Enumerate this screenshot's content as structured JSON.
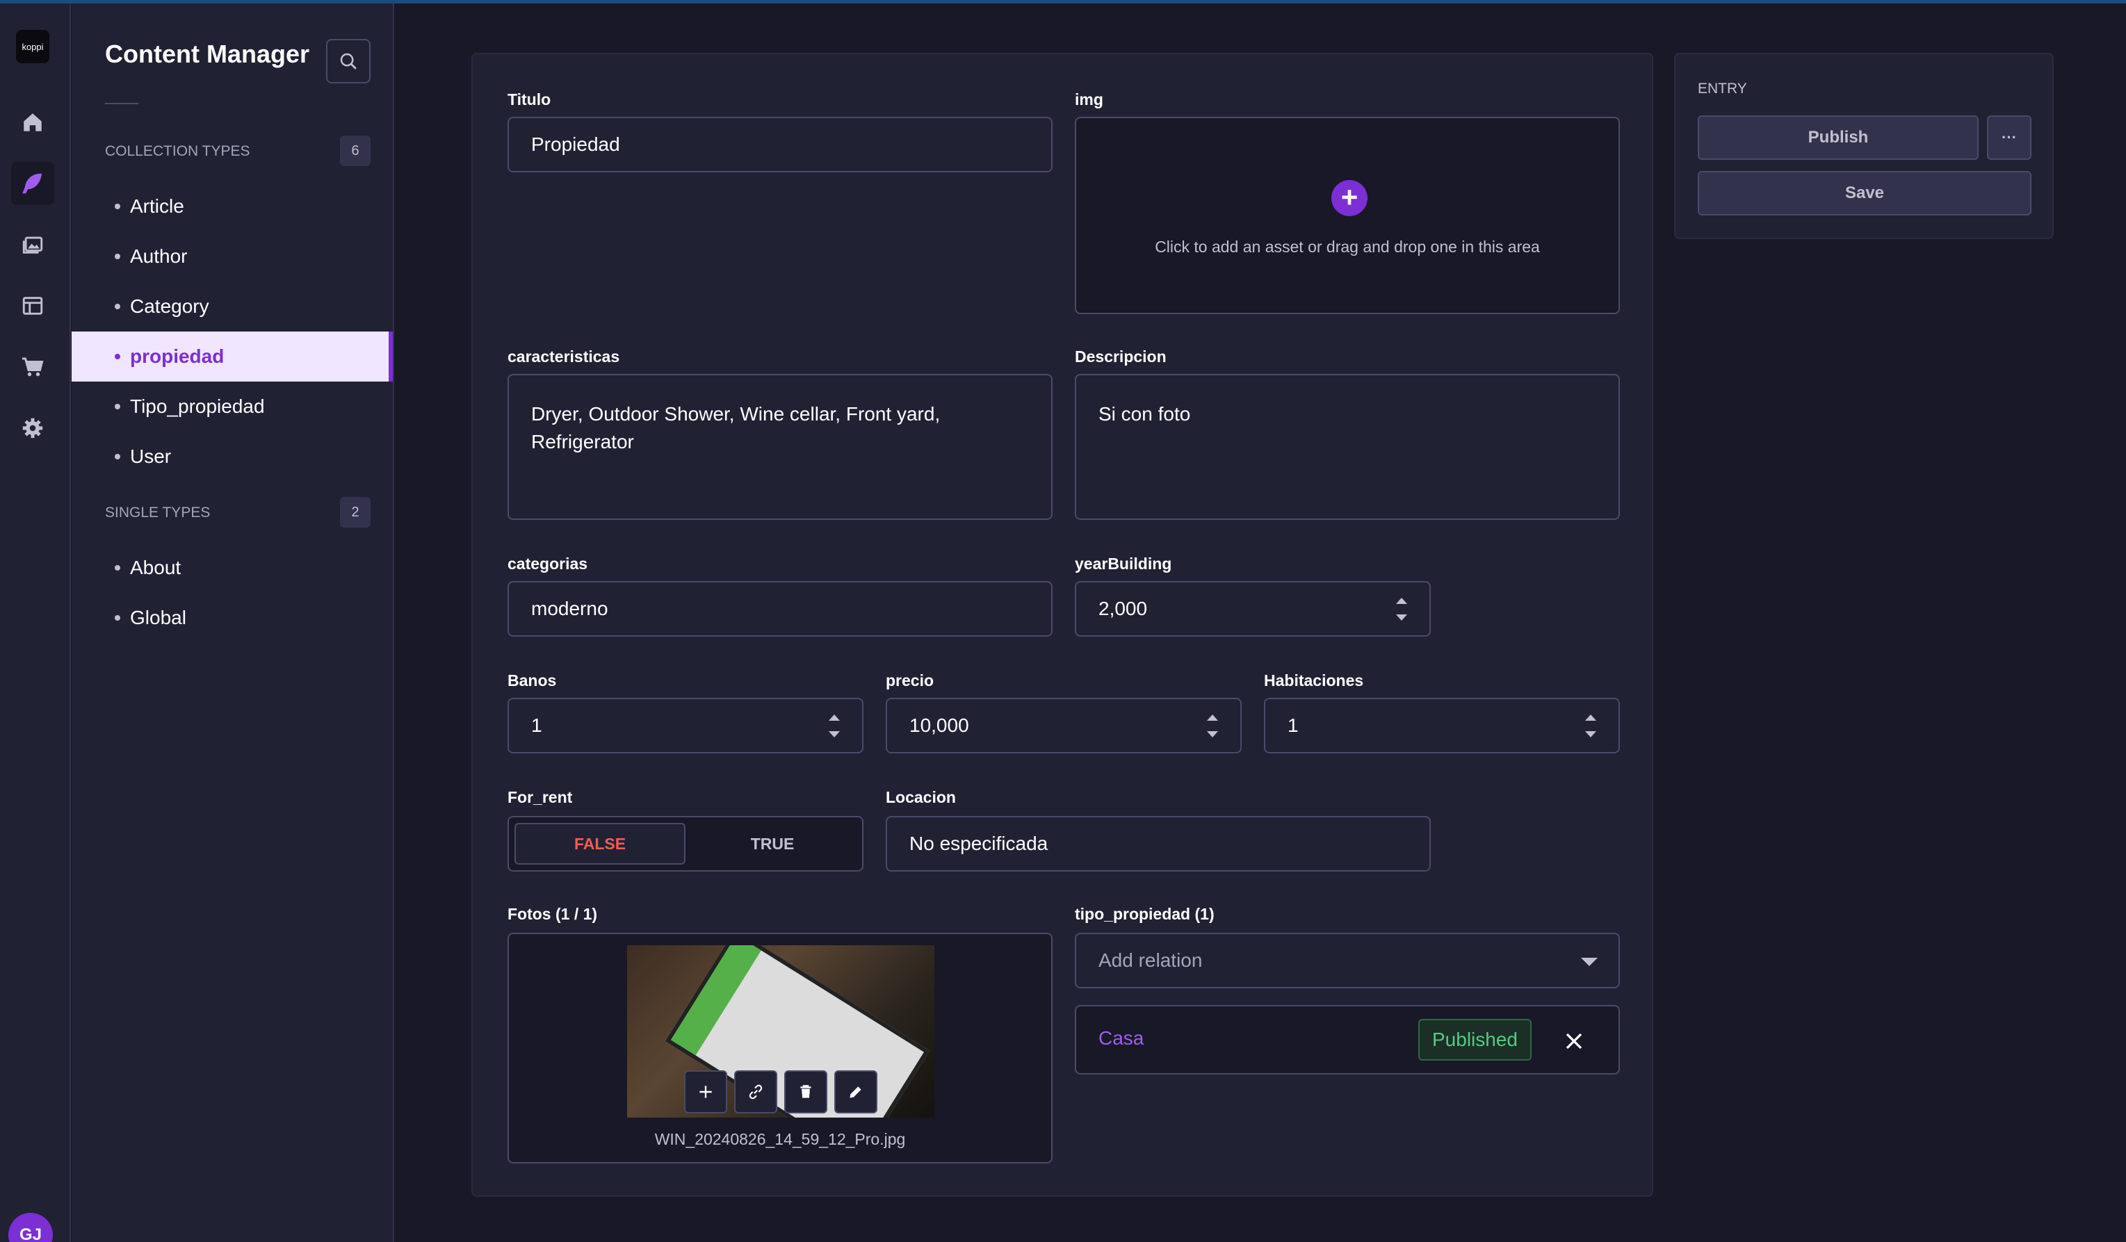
{
  "app": {
    "logo_text": "koppi",
    "avatar_initials": "GJ"
  },
  "subnav": {
    "title": "Content Manager",
    "collection_types": {
      "label": "COLLECTION TYPES",
      "count": "6",
      "items": [
        {
          "label": "Article"
        },
        {
          "label": "Author"
        },
        {
          "label": "Category"
        },
        {
          "label": "propiedad"
        },
        {
          "label": "Tipo_propiedad"
        },
        {
          "label": "User"
        }
      ]
    },
    "single_types": {
      "label": "SINGLE TYPES",
      "count": "2",
      "items": [
        {
          "label": "About"
        },
        {
          "label": "Global"
        }
      ]
    }
  },
  "form": {
    "titulo": {
      "label": "Titulo",
      "value": "Propiedad"
    },
    "img": {
      "label": "img",
      "hint": "Click to add an asset or drag and drop one in this area"
    },
    "caracteristicas": {
      "label": "caracteristicas",
      "value": "Dryer, Outdoor Shower, Wine cellar, Front yard, Refrigerator"
    },
    "descripcion": {
      "label": "Descripcion",
      "value": "Si con foto"
    },
    "categorias": {
      "label": "categorias",
      "value": "moderno"
    },
    "yearBuilding": {
      "label": "yearBuilding",
      "value": "2,000"
    },
    "banos": {
      "label": "Banos",
      "value": "1"
    },
    "precio": {
      "label": "precio",
      "value": "10,000"
    },
    "habitaciones": {
      "label": "Habitaciones",
      "value": "1"
    },
    "for_rent": {
      "label": "For_rent",
      "false_label": "FALSE",
      "true_label": "TRUE",
      "selected": "FALSE"
    },
    "locacion": {
      "label": "Locacion",
      "value": "No especificada"
    },
    "fotos": {
      "label": "Fotos (1 / 1)",
      "filename": "WIN_20240826_14_59_12_Pro.jpg"
    },
    "tipo_propiedad": {
      "label": "tipo_propiedad (1)",
      "placeholder": "Add relation",
      "item_name": "Casa",
      "item_status": "Published"
    }
  },
  "entry": {
    "label": "ENTRY",
    "publish": "Publish",
    "more": "···",
    "save": "Save"
  },
  "colors": {
    "accent": "#7b2fd4",
    "background": "#181826",
    "surface": "#212134",
    "published": "#55cb84",
    "false_value": "#ee5e52"
  }
}
